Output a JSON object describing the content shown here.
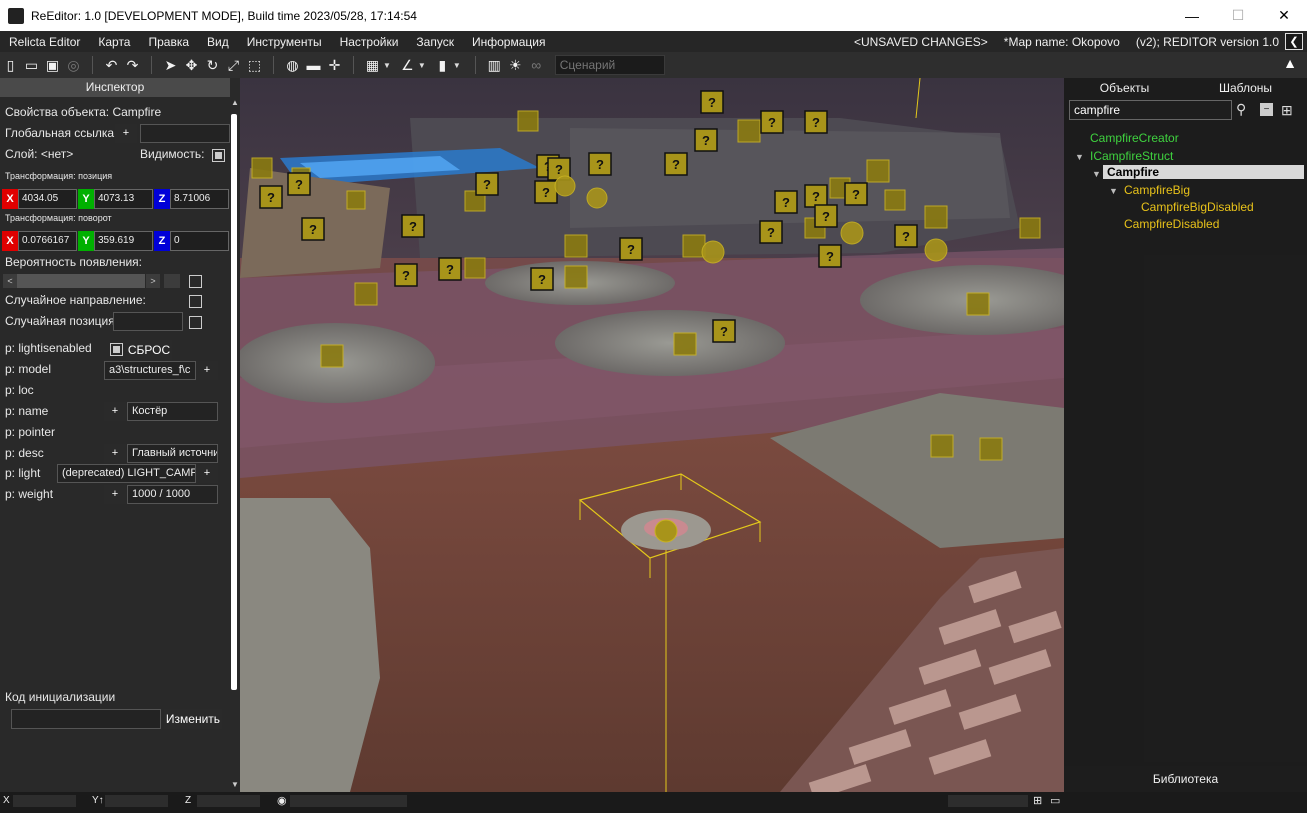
{
  "window": {
    "title": "ReEditor: 1.0 [DEVELOPMENT MODE], Build time 2023/05/28, 17:14:54",
    "minimize": "—",
    "maximize": "☐",
    "close": "✕"
  },
  "menu": {
    "items": [
      "Relicta Editor",
      "Карта",
      "Правка",
      "Вид",
      "Инструменты",
      "Настройки",
      "Запуск",
      "Информация"
    ],
    "unsaved": "<UNSAVED CHANGES>",
    "map_name": "*Map name: Okopovo",
    "version": "(v2); REDITOR version 1.0"
  },
  "toolbar": {
    "scenario_placeholder": "Сценарий"
  },
  "inspector": {
    "header": "Инспектор",
    "object_props": "Свойства объекта: Campfire",
    "global_ref": "Глобальная ссылка:",
    "layer": "Слой: <нет>",
    "visibility": "Видимость:",
    "transform_pos": "Трансформация: позиция",
    "pos_x": "4034.05",
    "pos_y": "4073.13",
    "pos_z": "8.71006",
    "transform_rot": "Трансформация: поворот",
    "rot_x": "0.0766167",
    "rot_y": "359.619",
    "rot_z": "0",
    "axis_x": "X",
    "axis_y": "Y",
    "axis_z": "Z",
    "spawn_chance": "Вероятность появления:",
    "random_dir": "Случайное направление:",
    "random_pos": "Случайная позиция",
    "props": {
      "lightisenabled": "p: lightisenabled",
      "reset": "СБРОС",
      "model": "p: model",
      "model_value": "a3\\structures_f\\c",
      "loc": "p: loc",
      "name": "p: name",
      "name_value": "Костёр",
      "pointer": "p: pointer",
      "desc": "p: desc",
      "desc_value": "Главный источни",
      "light": "p: light",
      "light_value": "(deprecated) LIGHT_CAMP",
      "weight": "p: weight",
      "weight_value": "1000 / 1000"
    },
    "plus": "+",
    "init_code": "Код инициализации",
    "change_btn": "Изменить"
  },
  "right_panel": {
    "tab_objects": "Объекты",
    "tab_templates": "Шаблоны",
    "search_value": "campfire",
    "tree": [
      {
        "label": "CampfireCreator",
        "color": "#3fd23f"
      },
      {
        "label": "ICampfireStruct",
        "color": "#3fd23f"
      },
      {
        "label": "Campfire",
        "color": "#000000"
      },
      {
        "label": "CampfireBig",
        "color": "#e8c21a"
      },
      {
        "label": "CampfireBigDisabled",
        "color": "#e8c21a"
      },
      {
        "label": "CampfireDisabled",
        "color": "#e8c21a"
      }
    ],
    "library": "Библиотека"
  },
  "statusbar": {
    "x_label": "X",
    "y_label": "Y↑",
    "z_label": "Z"
  },
  "colors": {
    "accent_yellow": "#e8c21a",
    "green_text": "#3fd23f",
    "axis_x": "#e00000",
    "axis_y": "#00b000",
    "axis_z": "#0000d8"
  }
}
